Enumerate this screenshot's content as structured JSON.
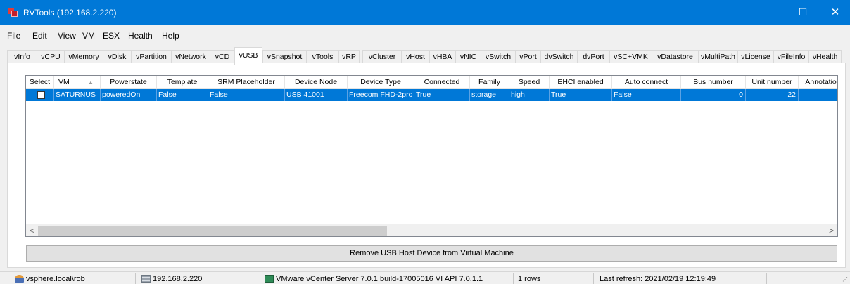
{
  "window": {
    "title": "RVTools (192.168.2.220)",
    "minimize_glyph": "—",
    "maximize_glyph": "☐",
    "close_glyph": "✕"
  },
  "menu": [
    "File",
    "Edit",
    "View",
    "VM",
    "ESX",
    "Health",
    "Help"
  ],
  "tabs": [
    "vInfo",
    "vCPU",
    "vMemory",
    "vDisk",
    "vPartition",
    "vNetwork",
    "vCD",
    "vUSB",
    "vSnapshot",
    "vTools",
    "vRP",
    "vCluster",
    "vHost",
    "vHBA",
    "vNIC",
    "vSwitch",
    "vPort",
    "dvSwitch",
    "dvPort",
    "vSC+VMK",
    "vDatastore",
    "vMultiPath",
    "vLicense",
    "vFileInfo",
    "vHealth"
  ],
  "active_tab": "vUSB",
  "grid": {
    "columns": [
      "Select",
      "VM",
      "Powerstate",
      "Template",
      "SRM Placeholder",
      "Device Node",
      "Device Type",
      "Connected",
      "Family",
      "Speed",
      "EHCI enabled",
      "Auto connect",
      "Bus number",
      "Unit number",
      "Annotation"
    ],
    "sort_glyph": "▲",
    "rows": [
      {
        "selected": false,
        "vm": "SATURNUS",
        "powerstate": "poweredOn",
        "template": "False",
        "srm_placeholder": "False",
        "device_node": "USB 41001",
        "device_type": "Freecom FHD-2pro",
        "connected": "True",
        "family": "storage",
        "speed": "high",
        "ehci_enabled": "True",
        "auto_connect": "False",
        "bus_number": "0",
        "unit_number": "22",
        "annotation": ""
      }
    ],
    "scroll_left_glyph": "<",
    "scroll_right_glyph": ">"
  },
  "action_button": "Remove USB Host Device from Virtual Machine",
  "status": {
    "user": "vsphere.local\\rob",
    "host": "192.168.2.220",
    "server": "VMware vCenter Server 7.0.1 build-17005016  VI API 7.0.1.1",
    "rows": "1 rows",
    "last_refresh": "Last refresh: 2021/02/19 12:19:49",
    "grip_glyph": "⋰"
  },
  "colors": {
    "title_bar": "#0078d7",
    "selection": "#0078d7"
  }
}
